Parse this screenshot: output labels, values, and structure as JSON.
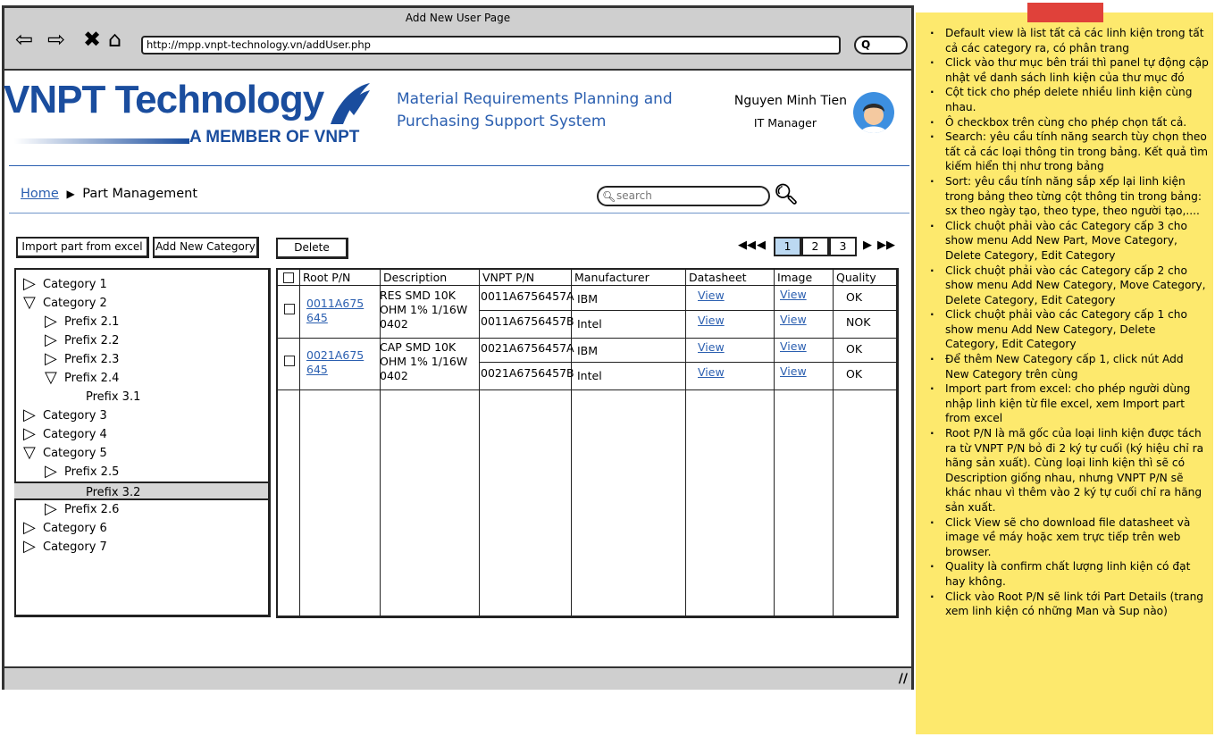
{
  "window": {
    "title": "Add New User Page",
    "url": "http://mpp.vnpt-technology.vn/addUser.php",
    "url_search": "Q"
  },
  "header": {
    "logo_main": "VNPT Technology",
    "logo_sub": "A MEMBER OF VNPT",
    "system_title": "Material Requirements Planning and Purchasing Support System",
    "user_name": "Nguyen Minh Tien",
    "user_role": "IT Manager"
  },
  "breadcrumb": {
    "home": "Home",
    "current": "Part Management"
  },
  "search": {
    "placeholder": "search"
  },
  "toolbar": {
    "import_label": "Import part from excel",
    "add_category_label": "Add New Category",
    "delete_label": "Delete"
  },
  "pagination": {
    "pages": [
      "1",
      "2",
      "3"
    ],
    "active": "1"
  },
  "tree": [
    {
      "label": "Category 1",
      "level": 0,
      "state": "collapsed"
    },
    {
      "label": "Category 2",
      "level": 0,
      "state": "expanded"
    },
    {
      "label": "Prefix 2.1",
      "level": 1,
      "state": "collapsed"
    },
    {
      "label": "Prefix 2.2",
      "level": 1,
      "state": "collapsed"
    },
    {
      "label": "Prefix 2.3",
      "level": 1,
      "state": "collapsed"
    },
    {
      "label": "Prefix 2.4",
      "level": 1,
      "state": "expanded"
    },
    {
      "label": "Prefix 3.1",
      "level": 2,
      "state": "leaf"
    },
    {
      "label": "Category 3",
      "level": 0,
      "state": "collapsed"
    },
    {
      "label": "Category 4",
      "level": 0,
      "state": "collapsed"
    },
    {
      "label": "Category 5",
      "level": 0,
      "state": "expanded"
    },
    {
      "label": "Prefix 2.5",
      "level": 1,
      "state": "collapsed"
    },
    {
      "label": "Prefix 3.2",
      "level": 2,
      "state": "leaf",
      "selected": true
    },
    {
      "label": "Prefix 2.6",
      "level": 1,
      "state": "collapsed"
    },
    {
      "label": "Category 6",
      "level": 0,
      "state": "collapsed"
    },
    {
      "label": "Category 7",
      "level": 0,
      "state": "collapsed"
    }
  ],
  "table": {
    "columns": [
      "Root P/N",
      "Description",
      "VNPT P/N",
      "Manufacturer",
      "Datasheet",
      "Image",
      "Quality"
    ],
    "groups": [
      {
        "root_pn": "0011A675645",
        "description": "RES SMD 10K OHM 1% 1/16W 0402",
        "rows": [
          {
            "vnpt_pn": "0011A6756457A",
            "manufacturer": "IBM",
            "datasheet": "View",
            "image": "View",
            "quality": "OK"
          },
          {
            "vnpt_pn": "0011A6756457B",
            "manufacturer": "Intel",
            "datasheet": "View",
            "image": "View",
            "quality": "NOK"
          }
        ]
      },
      {
        "root_pn": "0021A675645",
        "description": "CAP SMD 10K OHM 1% 1/16W 0402",
        "rows": [
          {
            "vnpt_pn": "0021A6756457A",
            "manufacturer": "IBM",
            "datasheet": "View",
            "image": "View",
            "quality": "OK"
          },
          {
            "vnpt_pn": "0021A6756457B",
            "manufacturer": "Intel",
            "datasheet": "View",
            "image": "View",
            "quality": "OK"
          }
        ]
      }
    ]
  },
  "notes": [
    "Default view là list tất cả các linh kiện trong tất cả các category ra, có phân trang",
    "Click vào thư mục bên trái thì panel tự động cập nhật về danh sách linh kiện của thư mục đó",
    "Cột tick cho phép delete nhiều linh kiện cùng nhau.",
    "Ô checkbox trên cùng cho phép chọn tất cả.",
    "Search: yêu cầu tính năng search tùy chọn theo tất cả các loại thông tin trong bảng. Kết quả tìm kiếm hiển thị như trong bảng",
    "Sort: yêu cầu tính năng sắp xếp lại linh kiện trong bảng theo từng cột thông tin trong bảng: sx theo ngày tạo, theo type, theo người tạo,....",
    "Click chuột phải vào các Category cấp 3 cho show menu Add New Part, Move Category, Delete Category, Edit Category",
    "Click chuột phải vào các Category cấp 2 cho show menu Add New Category, Move Category, Delete Category, Edit Category",
    "Click chuột phải vào các Category cấp 1 cho show menu Add New Category, Delete Category, Edit Category",
    "Để thêm New Category cấp 1, click nút Add New Category trên cùng",
    "Import part from excel: cho phép người dùng nhập linh kiện từ file excel, xem Import part from excel",
    "Root P/N là mã gốc của loại linh kiện được tách ra từ VNPT P/N bỏ đi 2 ký tự cuối (ký hiệu chỉ ra hãng sản xuất). Cùng loại linh kiện thì sẽ có Description giống nhau, nhưng VNPT P/N sẽ khác nhau vì thêm vào 2 ký tự cuối chỉ ra hãng sản xuất.",
    "Click View sẽ cho download file datasheet và image về máy hoặc xem trực tiếp trên web browser.",
    "Quality là confirm chất lượng linh kiện có đạt hay không.",
    "Click vào Root P/N sẽ link tới Part Details (trang xem linh kiện có những Man và Sup nào)"
  ],
  "colors": {
    "brand": "#1a4d9e",
    "link": "#2b5fb0",
    "note_bg": "#fde96d",
    "tape": "#e0413a"
  }
}
